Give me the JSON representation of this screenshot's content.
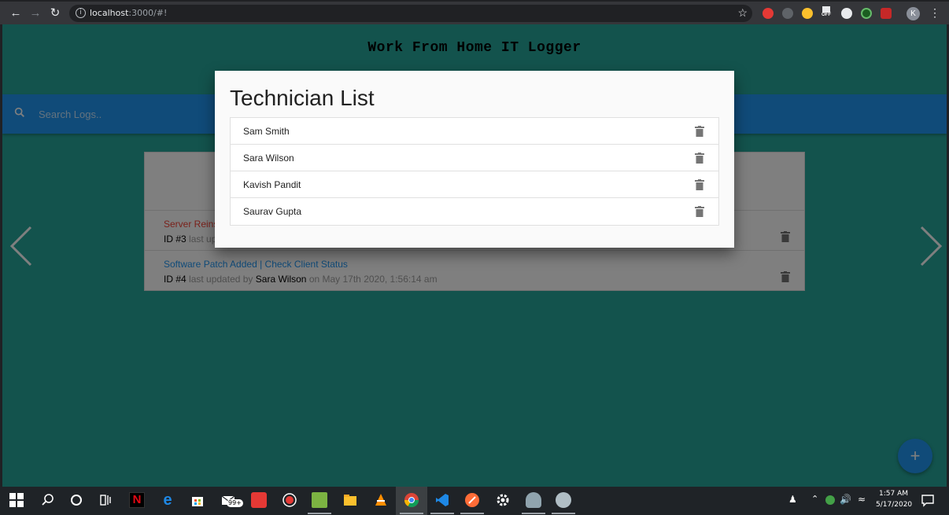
{
  "browser": {
    "url_host": "localhost",
    "url_rest": ":3000/#!",
    "profile_initial": "K",
    "ext_off_label": "OFF"
  },
  "app": {
    "title": "Work From Home IT Logger",
    "search_placeholder": "Search Logs.."
  },
  "logs": [
    {
      "title": "Server Reinst",
      "id": "ID #3",
      "meta_prefix": "last up",
      "user": "",
      "meta_suffix": "",
      "color": "#f44336"
    },
    {
      "title": "Software Patch Added | Check Client Status",
      "id": "ID #4",
      "meta_prefix": "last updated by",
      "user": "Sara Wilson",
      "meta_suffix": "on May 17th 2020, 1:56:14 am",
      "color": "#2196f3"
    }
  ],
  "modal": {
    "title": "Technician List",
    "technicians": [
      "Sam Smith",
      "Sara Wilson",
      "Kavish Pandit",
      "Saurav Gupta"
    ]
  },
  "fab": {
    "label": "+"
  },
  "taskbar": {
    "badge": "99+",
    "time": "1:57 AM",
    "date": "5/17/2020"
  },
  "colors": {
    "page_bg": "#26a69a",
    "search_bar": "#2196f3",
    "alert_red": "#f44336"
  }
}
